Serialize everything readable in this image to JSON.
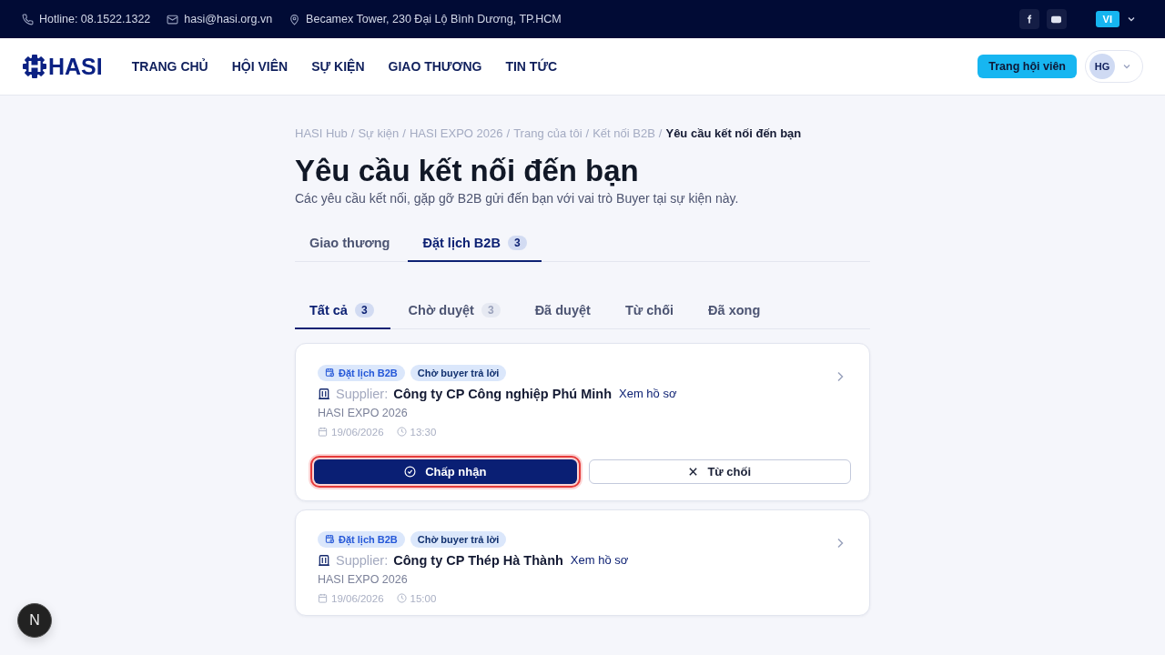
{
  "topbar": {
    "hotline": "Hotline: 08.1522.1322",
    "email": "hasi@hasi.org.vn",
    "address": "Becamex Tower, 230 Đại Lộ Bình Dương, TP.HCM",
    "language": "VI"
  },
  "header": {
    "logo": "HASI",
    "nav": [
      {
        "label": "TRANG CHỦ"
      },
      {
        "label": "HỘI VIÊN"
      },
      {
        "label": "SỰ KIỆN"
      },
      {
        "label": "GIAO THƯƠNG"
      },
      {
        "label": "TIN TỨC"
      }
    ],
    "member_button": "Trang hội viên",
    "avatar": "HG"
  },
  "breadcrumb": [
    {
      "label": "HASI Hub",
      "separator": "/"
    },
    {
      "label": "Sự kiện",
      "separator": "/"
    },
    {
      "label": "HASI EXPO 2026",
      "separator": "/"
    },
    {
      "label": "Trang của tôi",
      "separator": "/"
    },
    {
      "label": "Kết nối B2B",
      "separator": "/"
    },
    {
      "label": "Yêu cầu kết nối đến bạn"
    }
  ],
  "title": "Yêu cầu kết nối đến bạn",
  "subtitle": "Các yêu cầu kết nối, gặp gỡ B2B gửi đến bạn với vai trò Buyer tại sự kiện này.",
  "tabs": [
    {
      "label": "Giao thương",
      "selected": false
    },
    {
      "label": "Đặt lịch B2B",
      "count": "3",
      "selected": true
    }
  ],
  "filters": [
    {
      "label": "Tất cả",
      "count": "3",
      "selected": true
    },
    {
      "label": "Chờ duyệt",
      "count": "3",
      "selected": false
    },
    {
      "label": "Đã duyệt",
      "selected": false
    },
    {
      "label": "Từ chối",
      "selected": false
    },
    {
      "label": "Đã xong",
      "selected": false
    }
  ],
  "requests": [
    {
      "type_tag": "Đặt lịch B2B",
      "status_tag": "Chờ buyer trả lời",
      "role": "Supplier:",
      "company": "Công ty CP Công nghiệp Phú Minh",
      "profile_link": "Xem hồ sơ",
      "event": "HASI EXPO 2026",
      "date": "19/06/2026",
      "time": "13:30",
      "actions": [
        {
          "kind": "accept",
          "label": "Chấp nhận",
          "focused": true
        },
        {
          "kind": "reject",
          "label": "Từ chối",
          "focused": false
        }
      ]
    },
    {
      "type_tag": "Đặt lịch B2B",
      "status_tag": "Chờ buyer trả lời",
      "role": "Supplier:",
      "company": "Công ty CP Thép Hà Thành",
      "profile_link": "Xem hồ sơ",
      "event": "HASI EXPO 2026",
      "date": "19/06/2026",
      "time": "15:00"
    }
  ],
  "dev_badge": "N"
}
